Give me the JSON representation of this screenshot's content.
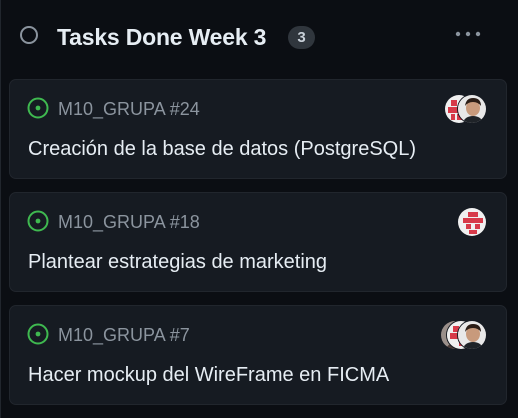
{
  "column": {
    "title": "Tasks Done Week 3",
    "count": "3",
    "more_icon": "kebab-horizontal-icon",
    "status_icon": "circle-icon"
  },
  "cards": [
    {
      "ref": "M10_GRUPA #24",
      "title": "Creación de la base de datos (PostgreSQL)",
      "issue_icon": "issue-opened-icon",
      "avatars": [
        "identicon-avatar",
        "user-photo-avatar"
      ]
    },
    {
      "ref": "M10_GRUPA #18",
      "title": "Plantear estrategias de marketing",
      "issue_icon": "issue-opened-icon",
      "avatars": [
        "identicon-avatar"
      ]
    },
    {
      "ref": "M10_GRUPA #7",
      "title": "Hacer mockup del WireFrame en FICMA",
      "issue_icon": "issue-opened-icon",
      "avatars": [
        "user-photo-avatar-2",
        "identicon-avatar",
        "user-photo-avatar"
      ]
    }
  ],
  "colors": {
    "background": "#0b0e13",
    "card": "#161b22",
    "open_green": "#3fb950",
    "muted": "#8b949e",
    "identicon": "#d73a49"
  }
}
